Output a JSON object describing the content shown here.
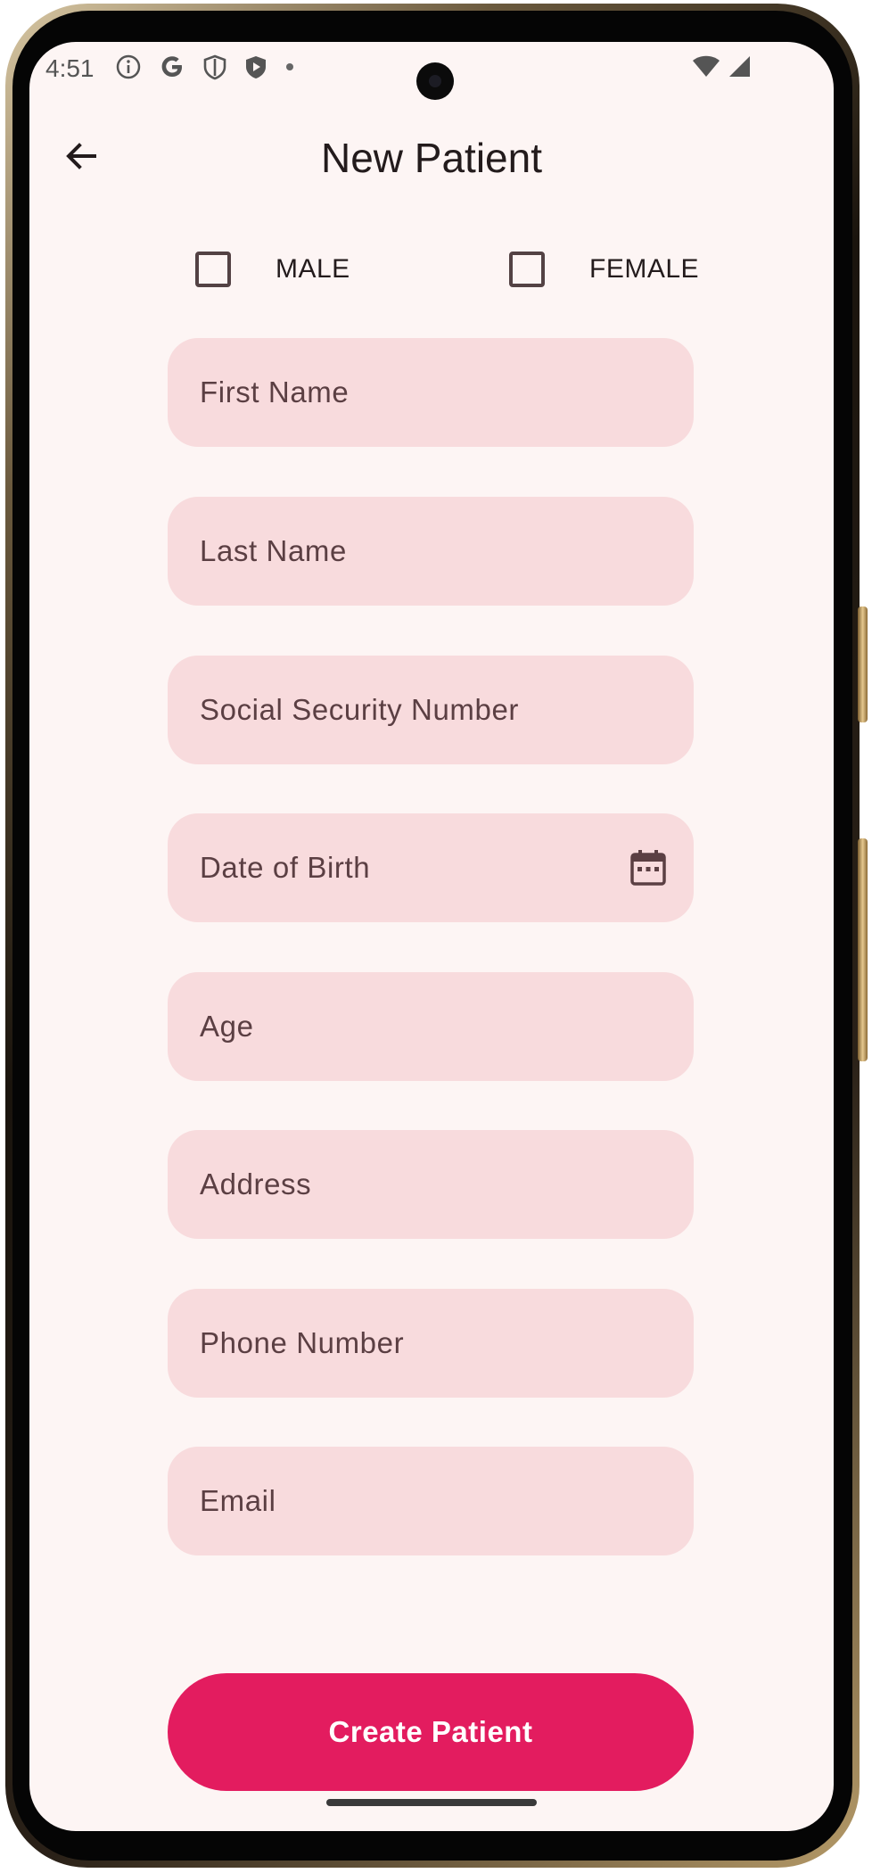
{
  "status_bar": {
    "time": "4:51",
    "icons_left": [
      "info-icon",
      "google-icon",
      "shield-icon",
      "play-shield-icon",
      "dot-icon"
    ],
    "icons_right": [
      "wifi-icon",
      "cellular-signal-icon"
    ]
  },
  "app_bar": {
    "title": "New Patient",
    "back_icon": "arrow-back-icon"
  },
  "gender": {
    "male_label": "MALE",
    "male_checked": false,
    "female_label": "FEMALE",
    "female_checked": false
  },
  "form": {
    "first_name": "First Name",
    "last_name": "Last Name",
    "ssn": "Social Security Number",
    "dob": "Date of Birth",
    "dob_icon": "calendar-icon",
    "age": "Age",
    "address": "Address",
    "phone": "Phone Number",
    "email": "Email"
  },
  "actions": {
    "create_label": "Create Patient"
  },
  "colors": {
    "background": "#fdf5f4",
    "field": "#f8dbdd",
    "field_text": "#5b3f43",
    "primary_button": "#e31c5f",
    "title_text": "#231b1c"
  }
}
